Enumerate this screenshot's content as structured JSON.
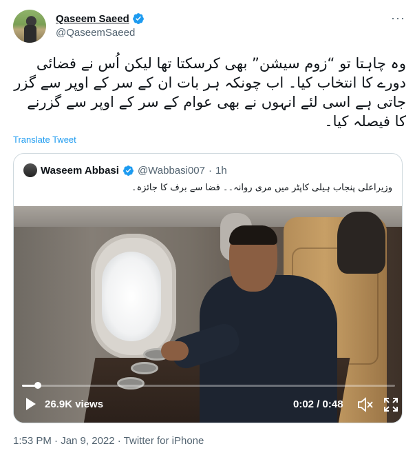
{
  "tweet": {
    "author": {
      "display_name": "Qaseem Saeed",
      "handle": "@QaseemSaeed",
      "verified": true
    },
    "text": "وہ چاہتا تو “زوم سیشن” بھی کرسکتا تھا لیکن اُس نے فضائی دورے کا انتخاب کیا۔ اب چونکہ ہر بات ان کے سر کے اوپر سے گزر جاتی ہے اسی لئے انہوں نے بھی عوام کے سر کے اوپر سے گزرنے کا فیصلہ کیا۔",
    "translate_label": "Translate Tweet",
    "more_icon": "more-icon",
    "meta": {
      "timestamp": "1:53 PM · Jan 9, 2022 · Twitter for iPhone"
    }
  },
  "quote": {
    "author": {
      "display_name": "Waseem Abbasi",
      "handle": "@Wabbasi007",
      "separator": "·",
      "age": "1h",
      "verified": true
    },
    "text": "وزیراعلی پنجاب ہیلی کاپٹر میں مری روانہ۔۔ فضا سے برف کا جائزہ۔",
    "video": {
      "views": "26.9K views",
      "time": "0:02 / 0:48",
      "progress": 0.042,
      "icons": [
        "play-icon",
        "mute-icon",
        "fullscreen-icon"
      ]
    }
  },
  "colors": {
    "accent": "#1d9bf0",
    "text_primary": "#0f1419",
    "text_secondary": "#536471",
    "border": "#cfd9de"
  }
}
